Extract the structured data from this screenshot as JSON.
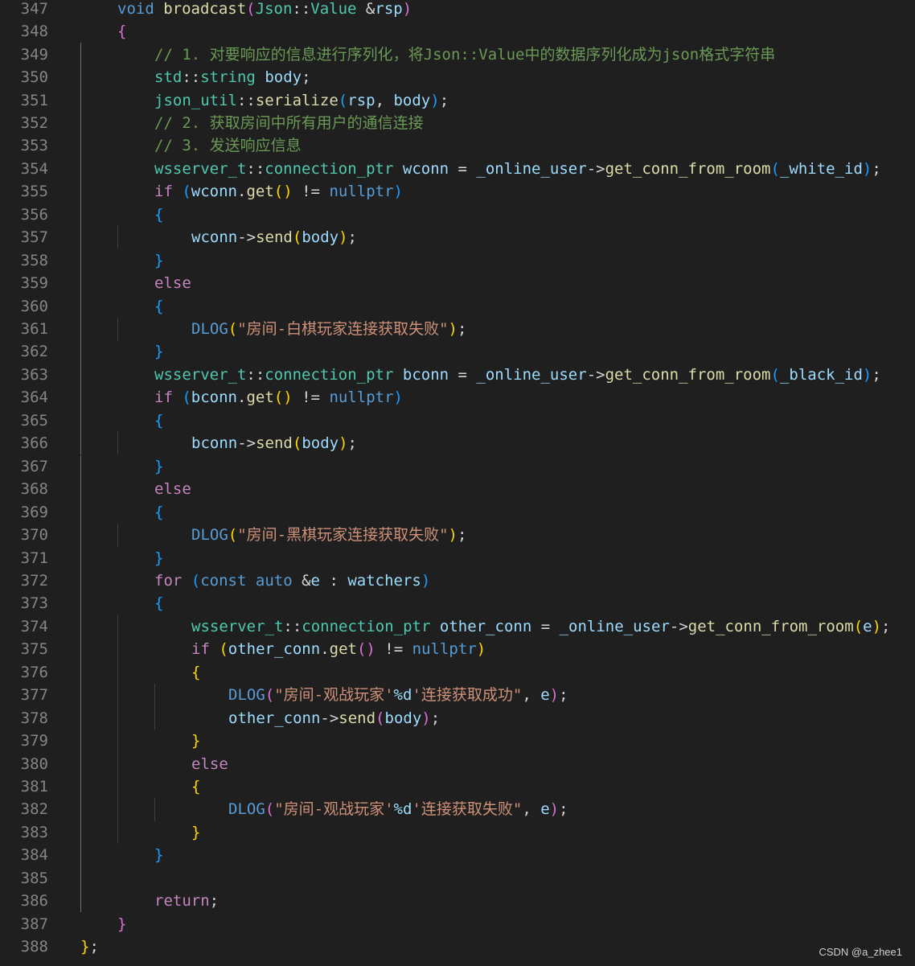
{
  "editor": {
    "lines": [
      {
        "n": "347",
        "indent": 1,
        "tokens": [
          [
            "kw",
            "void"
          ],
          [
            "op",
            " "
          ],
          [
            "fn",
            "broadcast"
          ],
          [
            "b2",
            "("
          ],
          [
            "ty",
            "Json"
          ],
          [
            "op",
            "::"
          ],
          [
            "ty",
            "Value"
          ],
          [
            "op",
            " &"
          ],
          [
            "var",
            "rsp"
          ],
          [
            "b2",
            ")"
          ]
        ]
      },
      {
        "n": "348",
        "indent": 1,
        "tokens": [
          [
            "b2",
            "{"
          ]
        ]
      },
      {
        "n": "349",
        "indent": 2,
        "tokens": [
          [
            "cmt",
            "// 1. 对要响应的信息进行序列化，将Json::Value中的数据序列化成为json格式字符串"
          ]
        ]
      },
      {
        "n": "350",
        "indent": 2,
        "tokens": [
          [
            "ty",
            "std"
          ],
          [
            "op",
            "::"
          ],
          [
            "ty",
            "string"
          ],
          [
            "op",
            " "
          ],
          [
            "var",
            "body"
          ],
          [
            "op",
            ";"
          ]
        ]
      },
      {
        "n": "351",
        "indent": 2,
        "tokens": [
          [
            "ty",
            "json_util"
          ],
          [
            "op",
            "::"
          ],
          [
            "fn",
            "serialize"
          ],
          [
            "b3",
            "("
          ],
          [
            "var",
            "rsp"
          ],
          [
            "op",
            ", "
          ],
          [
            "var",
            "body"
          ],
          [
            "b3",
            ")"
          ],
          [
            "op",
            ";"
          ]
        ]
      },
      {
        "n": "352",
        "indent": 2,
        "tokens": [
          [
            "cmt",
            "// 2. 获取房间中所有用户的通信连接"
          ]
        ]
      },
      {
        "n": "353",
        "indent": 2,
        "tokens": [
          [
            "cmt",
            "// 3. 发送响应信息"
          ]
        ]
      },
      {
        "n": "354",
        "indent": 2,
        "tokens": [
          [
            "ty",
            "wsserver_t"
          ],
          [
            "op",
            "::"
          ],
          [
            "ty",
            "connection_ptr"
          ],
          [
            "op",
            " "
          ],
          [
            "var",
            "wconn"
          ],
          [
            "op",
            " = "
          ],
          [
            "var",
            "_online_user"
          ],
          [
            "op",
            "->"
          ],
          [
            "fn",
            "get_conn_from_room"
          ],
          [
            "b3",
            "("
          ],
          [
            "var",
            "_white_id"
          ],
          [
            "b3",
            ")"
          ],
          [
            "op",
            ";"
          ]
        ]
      },
      {
        "n": "355",
        "indent": 2,
        "tokens": [
          [
            "ctl",
            "if"
          ],
          [
            "op",
            " "
          ],
          [
            "b3",
            "("
          ],
          [
            "var",
            "wconn"
          ],
          [
            "op",
            "."
          ],
          [
            "fn",
            "get"
          ],
          [
            "b1",
            "()"
          ],
          [
            "op",
            " != "
          ],
          [
            "kw",
            "nullptr"
          ],
          [
            "b3",
            ")"
          ]
        ]
      },
      {
        "n": "356",
        "indent": 2,
        "tokens": [
          [
            "b3",
            "{"
          ]
        ]
      },
      {
        "n": "357",
        "indent": 3,
        "tokens": [
          [
            "var",
            "wconn"
          ],
          [
            "op",
            "->"
          ],
          [
            "fn",
            "send"
          ],
          [
            "b1",
            "("
          ],
          [
            "var",
            "body"
          ],
          [
            "b1",
            ")"
          ],
          [
            "op",
            ";"
          ]
        ]
      },
      {
        "n": "358",
        "indent": 2,
        "tokens": [
          [
            "b3",
            "}"
          ]
        ]
      },
      {
        "n": "359",
        "indent": 2,
        "tokens": [
          [
            "ctl",
            "else"
          ]
        ]
      },
      {
        "n": "360",
        "indent": 2,
        "tokens": [
          [
            "b3",
            "{"
          ]
        ]
      },
      {
        "n": "361",
        "indent": 3,
        "tokens": [
          [
            "mac",
            "DLOG"
          ],
          [
            "b1",
            "("
          ],
          [
            "str",
            "\"房间-白棋玩家连接获取失败\""
          ],
          [
            "b1",
            ")"
          ],
          [
            "op",
            ";"
          ]
        ]
      },
      {
        "n": "362",
        "indent": 2,
        "tokens": [
          [
            "b3",
            "}"
          ]
        ]
      },
      {
        "n": "363",
        "indent": 2,
        "tokens": [
          [
            "ty",
            "wsserver_t"
          ],
          [
            "op",
            "::"
          ],
          [
            "ty",
            "connection_ptr"
          ],
          [
            "op",
            " "
          ],
          [
            "var",
            "bconn"
          ],
          [
            "op",
            " = "
          ],
          [
            "var",
            "_online_user"
          ],
          [
            "op",
            "->"
          ],
          [
            "fn",
            "get_conn_from_room"
          ],
          [
            "b3",
            "("
          ],
          [
            "var",
            "_black_id"
          ],
          [
            "b3",
            ")"
          ],
          [
            "op",
            ";"
          ]
        ]
      },
      {
        "n": "364",
        "indent": 2,
        "tokens": [
          [
            "ctl",
            "if"
          ],
          [
            "op",
            " "
          ],
          [
            "b3",
            "("
          ],
          [
            "var",
            "bconn"
          ],
          [
            "op",
            "."
          ],
          [
            "fn",
            "get"
          ],
          [
            "b1",
            "()"
          ],
          [
            "op",
            " != "
          ],
          [
            "kw",
            "nullptr"
          ],
          [
            "b3",
            ")"
          ]
        ]
      },
      {
        "n": "365",
        "indent": 2,
        "tokens": [
          [
            "b3",
            "{"
          ]
        ]
      },
      {
        "n": "366",
        "indent": 3,
        "tokens": [
          [
            "var",
            "bconn"
          ],
          [
            "op",
            "->"
          ],
          [
            "fn",
            "send"
          ],
          [
            "b1",
            "("
          ],
          [
            "var",
            "body"
          ],
          [
            "b1",
            ")"
          ],
          [
            "op",
            ";"
          ]
        ]
      },
      {
        "n": "367",
        "indent": 2,
        "tokens": [
          [
            "b3",
            "}"
          ]
        ]
      },
      {
        "n": "368",
        "indent": 2,
        "tokens": [
          [
            "ctl",
            "else"
          ]
        ]
      },
      {
        "n": "369",
        "indent": 2,
        "tokens": [
          [
            "b3",
            "{"
          ]
        ]
      },
      {
        "n": "370",
        "indent": 3,
        "tokens": [
          [
            "mac",
            "DLOG"
          ],
          [
            "b1",
            "("
          ],
          [
            "str",
            "\"房间-黑棋玩家连接获取失败\""
          ],
          [
            "b1",
            ")"
          ],
          [
            "op",
            ";"
          ]
        ]
      },
      {
        "n": "371",
        "indent": 2,
        "tokens": [
          [
            "b3",
            "}"
          ]
        ]
      },
      {
        "n": "372",
        "indent": 2,
        "tokens": [
          [
            "ctl",
            "for"
          ],
          [
            "op",
            " "
          ],
          [
            "b3",
            "("
          ],
          [
            "kw",
            "const"
          ],
          [
            "op",
            " "
          ],
          [
            "kw",
            "auto"
          ],
          [
            "op",
            " &"
          ],
          [
            "var",
            "e"
          ],
          [
            "op",
            " : "
          ],
          [
            "var",
            "watchers"
          ],
          [
            "b3",
            ")"
          ]
        ]
      },
      {
        "n": "373",
        "indent": 2,
        "tokens": [
          [
            "b3",
            "{"
          ]
        ]
      },
      {
        "n": "374",
        "indent": 3,
        "tokens": [
          [
            "ty",
            "wsserver_t"
          ],
          [
            "op",
            "::"
          ],
          [
            "ty",
            "connection_ptr"
          ],
          [
            "op",
            " "
          ],
          [
            "var",
            "other_conn"
          ],
          [
            "op",
            " = "
          ],
          [
            "var",
            "_online_user"
          ],
          [
            "op",
            "->"
          ],
          [
            "fn",
            "get_conn_from_room"
          ],
          [
            "b1",
            "("
          ],
          [
            "var",
            "e"
          ],
          [
            "b1",
            ")"
          ],
          [
            "op",
            ";"
          ]
        ]
      },
      {
        "n": "375",
        "indent": 3,
        "tokens": [
          [
            "ctl",
            "if"
          ],
          [
            "op",
            " "
          ],
          [
            "b1",
            "("
          ],
          [
            "var",
            "other_conn"
          ],
          [
            "op",
            "."
          ],
          [
            "fn",
            "get"
          ],
          [
            "b2",
            "()"
          ],
          [
            "op",
            " != "
          ],
          [
            "kw",
            "nullptr"
          ],
          [
            "b1",
            ")"
          ]
        ]
      },
      {
        "n": "376",
        "indent": 3,
        "tokens": [
          [
            "b1",
            "{"
          ]
        ]
      },
      {
        "n": "377",
        "indent": 4,
        "tokens": [
          [
            "mac",
            "DLOG"
          ],
          [
            "b2",
            "("
          ],
          [
            "str",
            "\"房间-观战玩家'"
          ],
          [
            "fmt",
            "%d"
          ],
          [
            "str",
            "'连接获取成功\""
          ],
          [
            "op",
            ", "
          ],
          [
            "var",
            "e"
          ],
          [
            "b2",
            ")"
          ],
          [
            "op",
            ";"
          ]
        ]
      },
      {
        "n": "378",
        "indent": 4,
        "tokens": [
          [
            "var",
            "other_conn"
          ],
          [
            "op",
            "->"
          ],
          [
            "fn",
            "send"
          ],
          [
            "b2",
            "("
          ],
          [
            "var",
            "body"
          ],
          [
            "b2",
            ")"
          ],
          [
            "op",
            ";"
          ]
        ]
      },
      {
        "n": "379",
        "indent": 3,
        "tokens": [
          [
            "b1",
            "}"
          ]
        ]
      },
      {
        "n": "380",
        "indent": 3,
        "tokens": [
          [
            "ctl",
            "else"
          ]
        ]
      },
      {
        "n": "381",
        "indent": 3,
        "tokens": [
          [
            "b1",
            "{"
          ]
        ]
      },
      {
        "n": "382",
        "indent": 4,
        "tokens": [
          [
            "mac",
            "DLOG"
          ],
          [
            "b2",
            "("
          ],
          [
            "str",
            "\"房间-观战玩家'"
          ],
          [
            "fmt",
            "%d"
          ],
          [
            "str",
            "'连接获取失败\""
          ],
          [
            "op",
            ", "
          ],
          [
            "var",
            "e"
          ],
          [
            "b2",
            ")"
          ],
          [
            "op",
            ";"
          ]
        ]
      },
      {
        "n": "383",
        "indent": 3,
        "tokens": [
          [
            "b1",
            "}"
          ]
        ]
      },
      {
        "n": "384",
        "indent": 2,
        "tokens": [
          [
            "b3",
            "}"
          ]
        ]
      },
      {
        "n": "385",
        "indent": 2,
        "tokens": []
      },
      {
        "n": "386",
        "indent": 2,
        "tokens": [
          [
            "ctl",
            "return"
          ],
          [
            "op",
            ";"
          ]
        ]
      },
      {
        "n": "387",
        "indent": 1,
        "tokens": [
          [
            "b2",
            "}"
          ]
        ]
      },
      {
        "n": "388",
        "indent": 0,
        "tokens": [
          [
            "b1",
            "}"
          ],
          [
            "op",
            ";"
          ]
        ]
      }
    ]
  },
  "watermark": "CSDN @a_zhee1"
}
